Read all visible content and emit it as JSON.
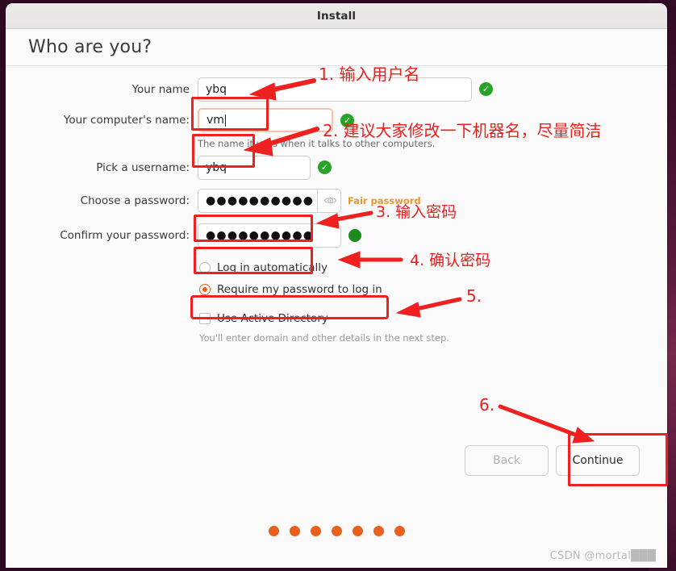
{
  "window": {
    "title": "Install"
  },
  "header": {
    "heading": "Who are you?"
  },
  "form": {
    "name": {
      "label": "Your name",
      "value": "ybq",
      "valid_icon": "check-circle-icon"
    },
    "computer_name": {
      "label": "Your computer's name:",
      "value": "vm",
      "hint": "The name it uses when it talks to other computers.",
      "valid_icon": "check-circle-icon"
    },
    "username": {
      "label": "Pick a username:",
      "value": "ybq",
      "valid_icon": "check-circle-icon"
    },
    "password": {
      "label": "Choose a password:",
      "value": "●●●●●●●●●●",
      "strength": "Fair password",
      "strength_color": "#e8972a",
      "reveal_icon": "eye-icon"
    },
    "confirm_password": {
      "label": "Confirm your password:",
      "value": "●●●●●●●●●●",
      "valid_icon": "dot-green-icon"
    },
    "options": {
      "auto_login": {
        "label": "Log in automatically",
        "selected": false
      },
      "require_password": {
        "label": "Require my password to log in",
        "selected": true
      },
      "active_directory": {
        "label": "Use Active Directory",
        "checked": false
      },
      "active_directory_hint": "You'll enter domain and other details in the next step."
    }
  },
  "buttons": {
    "back": "Back",
    "continue": "Continue"
  },
  "progress": {
    "dot_count": 7,
    "dot_color": "#e8601c"
  },
  "watermark": "CSDN @mortal███",
  "annotations": [
    {
      "id": 1,
      "text": "1. 输入用户名"
    },
    {
      "id": 2,
      "text": "2. 建议大家修改一下机器名，尽量简洁"
    },
    {
      "id": 3,
      "text": "3. 输入密码"
    },
    {
      "id": 4,
      "text": "4. 确认密码"
    },
    {
      "id": 5,
      "text": "5."
    },
    {
      "id": 6,
      "text": "6."
    }
  ],
  "colors": {
    "annotation_red": "#ef2020",
    "accent_orange": "#e8601c",
    "desktop_purple": "#2d0a22"
  }
}
